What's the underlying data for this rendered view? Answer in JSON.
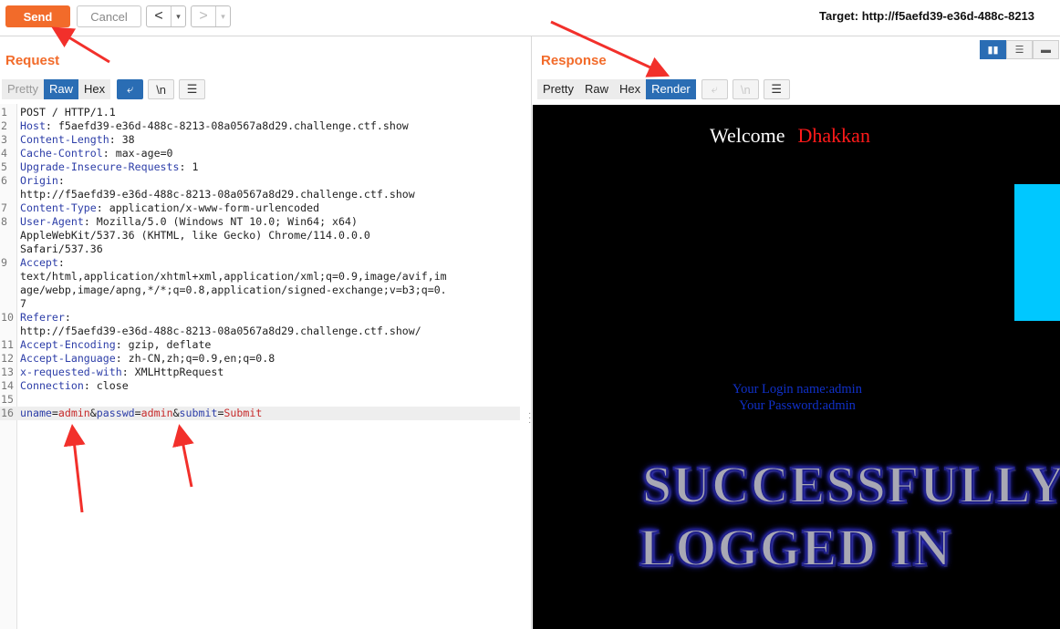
{
  "toolbar": {
    "send_label": "Send",
    "cancel_label": "Cancel",
    "back_glyph": "<",
    "forward_glyph": ">",
    "dropdown_glyph": "▾",
    "target_text": "Target: http://f5aefd39-e36d-488c-8213"
  },
  "request": {
    "title": "Request",
    "tabs": [
      "Pretty",
      "Raw",
      "Hex"
    ],
    "active_tab": "Raw",
    "icon_wrap": "⤶",
    "icon_newline": "\\n",
    "icon_menu": "☰",
    "lines": [
      {
        "n": "1",
        "segs": [
          {
            "t": "POST / HTTP/1.1",
            "c": "v"
          }
        ]
      },
      {
        "n": "2",
        "segs": [
          {
            "t": "Host",
            "c": "k"
          },
          {
            "t": ": f5aefd39-e36d-488c-8213-08a0567a8d29.challenge.ctf.show",
            "c": "v"
          }
        ]
      },
      {
        "n": "3",
        "segs": [
          {
            "t": "Content-Length",
            "c": "k"
          },
          {
            "t": ": 38",
            "c": "v"
          }
        ]
      },
      {
        "n": "4",
        "segs": [
          {
            "t": "Cache-Control",
            "c": "k"
          },
          {
            "t": ": max-age=0",
            "c": "v"
          }
        ]
      },
      {
        "n": "5",
        "segs": [
          {
            "t": "Upgrade-Insecure-Requests",
            "c": "k"
          },
          {
            "t": ": 1",
            "c": "v"
          }
        ]
      },
      {
        "n": "6",
        "segs": [
          {
            "t": "Origin",
            "c": "k"
          },
          {
            "t": ":",
            "c": "v"
          }
        ]
      },
      {
        "n": "",
        "segs": [
          {
            "t": "http://f5aefd39-e36d-488c-8213-08a0567a8d29.challenge.ctf.show",
            "c": "v"
          }
        ]
      },
      {
        "n": "7",
        "segs": [
          {
            "t": "Content-Type",
            "c": "k"
          },
          {
            "t": ": application/x-www-form-urlencoded",
            "c": "v"
          }
        ]
      },
      {
        "n": "8",
        "segs": [
          {
            "t": "User-Agent",
            "c": "k"
          },
          {
            "t": ": Mozilla/5.0 (Windows NT 10.0; Win64; x64)",
            "c": "v"
          }
        ]
      },
      {
        "n": "",
        "segs": [
          {
            "t": "AppleWebKit/537.36 (KHTML, like Gecko) Chrome/114.0.0.0",
            "c": "v"
          }
        ]
      },
      {
        "n": "",
        "segs": [
          {
            "t": "Safari/537.36",
            "c": "v"
          }
        ]
      },
      {
        "n": "9",
        "segs": [
          {
            "t": "Accept",
            "c": "k"
          },
          {
            "t": ":",
            "c": "v"
          }
        ]
      },
      {
        "n": "",
        "segs": [
          {
            "t": "text/html,application/xhtml+xml,application/xml;q=0.9,image/avif,im",
            "c": "v"
          }
        ]
      },
      {
        "n": "",
        "segs": [
          {
            "t": "age/webp,image/apng,*/*;q=0.8,application/signed-exchange;v=b3;q=0.",
            "c": "v"
          }
        ]
      },
      {
        "n": "",
        "segs": [
          {
            "t": "7",
            "c": "v"
          }
        ]
      },
      {
        "n": "10",
        "segs": [
          {
            "t": "Referer",
            "c": "k"
          },
          {
            "t": ":",
            "c": "v"
          }
        ]
      },
      {
        "n": "",
        "segs": [
          {
            "t": "http://f5aefd39-e36d-488c-8213-08a0567a8d29.challenge.ctf.show/",
            "c": "v"
          }
        ]
      },
      {
        "n": "11",
        "segs": [
          {
            "t": "Accept-Encoding",
            "c": "k"
          },
          {
            "t": ": gzip, deflate",
            "c": "v"
          }
        ]
      },
      {
        "n": "12",
        "segs": [
          {
            "t": "Accept-Language",
            "c": "k"
          },
          {
            "t": ": zh-CN,zh;q=0.9,en;q=0.8",
            "c": "v"
          }
        ]
      },
      {
        "n": "13",
        "segs": [
          {
            "t": "x-requested-with",
            "c": "k"
          },
          {
            "t": ": XMLHttpRequest",
            "c": "v"
          }
        ]
      },
      {
        "n": "14",
        "segs": [
          {
            "t": "Connection",
            "c": "k"
          },
          {
            "t": ": close",
            "c": "v"
          }
        ]
      },
      {
        "n": "15",
        "segs": [
          {
            "t": "",
            "c": "v"
          }
        ]
      },
      {
        "n": "16",
        "hl": true,
        "segs": [
          {
            "t": "uname",
            "c": "k"
          },
          {
            "t": "=",
            "c": "v"
          },
          {
            "t": "admin",
            "c": "r"
          },
          {
            "t": "&",
            "c": "v"
          },
          {
            "t": "passwd",
            "c": "k"
          },
          {
            "t": "=",
            "c": "v"
          },
          {
            "t": "admin",
            "c": "r"
          },
          {
            "t": "&",
            "c": "v"
          },
          {
            "t": "submit",
            "c": "k"
          },
          {
            "t": "=",
            "c": "v"
          },
          {
            "t": "Submit",
            "c": "r"
          }
        ]
      }
    ]
  },
  "response": {
    "title": "Response",
    "tabs": [
      "Pretty",
      "Raw",
      "Hex",
      "Render"
    ],
    "active_tab": "Render",
    "icon_wrap": "⤶",
    "icon_newline": "\\n",
    "icon_menu": "☰",
    "render": {
      "welcome_text": "Welcome",
      "welcome_name": "Dhakkan",
      "login_name_line": "Your Login name:admin",
      "password_line": "Your Password:admin",
      "banner_line1": "SUCCESSFULLY",
      "banner_line2": "LOGGED IN"
    }
  },
  "colors": {
    "accent": "#f26b2a",
    "tab_active": "#2a6db4",
    "annotation": "#f2302b"
  }
}
